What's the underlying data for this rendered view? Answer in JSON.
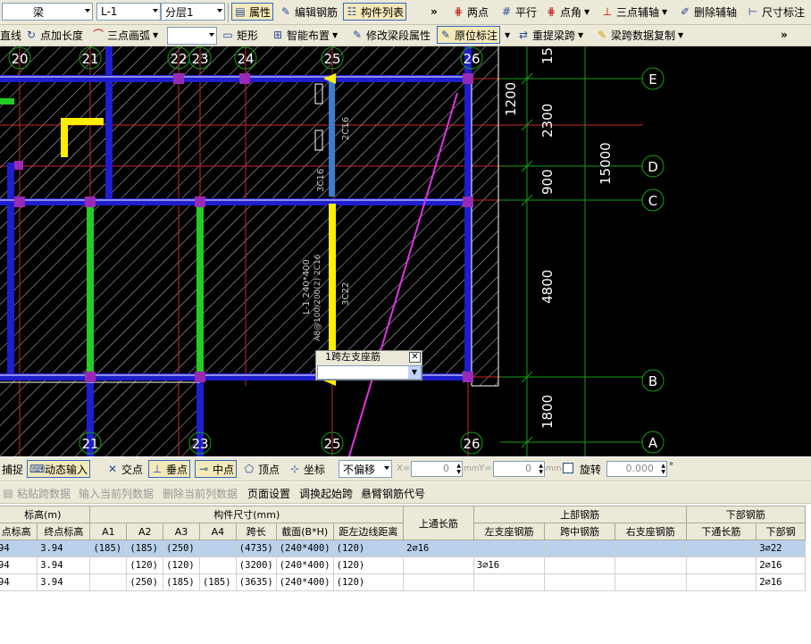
{
  "toolbar1": {
    "type_value": "梁",
    "name_value": "L-1",
    "layer_value": "分层1",
    "btn_attr": "属性",
    "btn_edit_rebar": "编辑钢筋",
    "btn_component_list": "构件列表",
    "btn_two_points": "两点",
    "btn_parallel": "平行",
    "btn_point_angle": "点角",
    "btn_three_point_axis": "三点辅轴",
    "btn_delete_axis": "删除辅轴",
    "btn_dimension": "尺寸标注",
    "more": "»"
  },
  "toolbar2": {
    "btn_line": "直线",
    "btn_point_length": "点加长度",
    "btn_arc": "三点画弧",
    "btn_rect": "矩形",
    "btn_smart": "智能布置",
    "btn_modify_beam": "修改梁段属性",
    "btn_in_situ": "原位标注",
    "btn_reextract": "重提梁跨",
    "btn_copy_span": "梁跨数据复制",
    "more": "»"
  },
  "canvas": {
    "axis_top": [
      "20",
      "21",
      "22",
      "23",
      "24",
      "25",
      "26"
    ],
    "axis_bottom": [
      "21",
      "23",
      "25",
      "26"
    ],
    "axis_right": [
      "E",
      "D",
      "C",
      "B",
      "A"
    ],
    "dims_inner": [
      "15",
      "1200",
      "2300",
      "900",
      "4800",
      "1800"
    ],
    "dim_total": "15000",
    "beam_text_1": "2C16",
    "beam_text_2": "3C16",
    "beam_text_3": "3C22",
    "beam_text_4": "L-1 240*400",
    "beam_text_5": "A8@100/200(2) 2C16",
    "popup_title": "1跨左支座筋",
    "popup_value": ""
  },
  "toolbar3": {
    "btn_snap": "捕捉",
    "btn_dynamic_input": "动态输入",
    "btn_intersection": "交点",
    "btn_perpendicular": "垂点",
    "btn_midpoint": "中点",
    "btn_vertex": "顶点",
    "btn_coordinate": "坐标",
    "offset_mode": "不偏移",
    "x_label": "X=",
    "x_value": "0",
    "y_label": "Y=",
    "y_value": "0",
    "unit": "mm",
    "rotate_label": "旋转",
    "rotate_value": "0.000",
    "degree": "°"
  },
  "toolbar4": {
    "btn_paste_span": "粘贴跨数据",
    "btn_input_column": "输入当前列数据",
    "btn_delete_column": "删除当前列数据",
    "btn_page_setup": "页面设置",
    "btn_swap_start": "调换起始跨",
    "btn_cantilever_code": "悬臂钢筋代号"
  },
  "grid": {
    "group_headers": [
      "标高(m)",
      "构件尺寸(mm)",
      "上通长筋",
      "上部钢筋",
      "下部钢筋"
    ],
    "columns": [
      "点标高",
      "终点标高",
      "A1",
      "A2",
      "A3",
      "A4",
      "跨长",
      "截面(B*H)",
      "距左边线距离",
      "左支座钢筋",
      "跨中钢筋",
      "右支座钢筋",
      "下通长筋",
      "下部钢"
    ],
    "rows": [
      [
        "94",
        "3.94",
        "(185)",
        "(185)",
        "(250)",
        "",
        "(4735)",
        "(240*400)",
        "(120)",
        "2⌀16",
        "",
        "",
        "",
        "",
        "3⌀22"
      ],
      [
        "94",
        "3.94",
        "",
        "(120)",
        "(120)",
        "",
        "(3200)",
        "(240*400)",
        "(120)",
        "",
        "3⌀16",
        "",
        "",
        "",
        "2⌀16"
      ],
      [
        "94",
        "3.94",
        "",
        "(250)",
        "(185)",
        "(185)",
        "(3635)",
        "(240*400)",
        "(120)",
        "",
        "",
        "",
        "",
        "",
        "2⌀16"
      ]
    ]
  },
  "colors": {
    "canvas_bg": "#000000",
    "beam_blue": "#1e1ecf",
    "axis_red": "#c8282d",
    "axis_green": "#15a015",
    "steel_yellow": "#ffee00",
    "steel_green": "#22cc22",
    "leader_magenta": "#e032e6",
    "selection": "#b9d1ea"
  }
}
